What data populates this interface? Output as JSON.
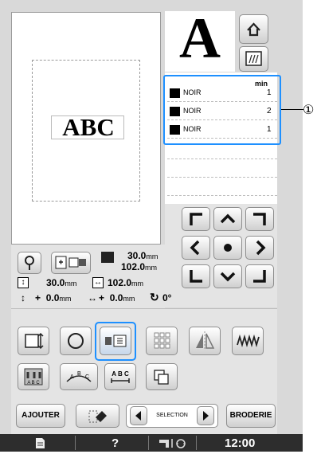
{
  "preview": {
    "text": "ABC"
  },
  "letter_preview": {
    "glyph": "A"
  },
  "thread_list": {
    "header": "min",
    "rows": [
      {
        "color_name": "NOIR",
        "minutes": "1"
      },
      {
        "color_name": "NOIR",
        "minutes": "2"
      },
      {
        "color_name": "NOIR",
        "minutes": "1"
      }
    ],
    "callout": "①"
  },
  "dimensions": {
    "height": "30.0",
    "width": "102.0",
    "unit": "mm",
    "size_h": "30.0",
    "size_w": "102.0",
    "offset_v_sign": "+",
    "offset_v": "0.0",
    "offset_h_sign": "+",
    "offset_h": "0.0",
    "angle": "0°"
  },
  "bottom_bar": {
    "add_label": "AJOUTER",
    "selection_label": "SELECTION",
    "embroider_label": "BRODERIE"
  },
  "status_bar": {
    "help": "?",
    "time": "12:00"
  }
}
